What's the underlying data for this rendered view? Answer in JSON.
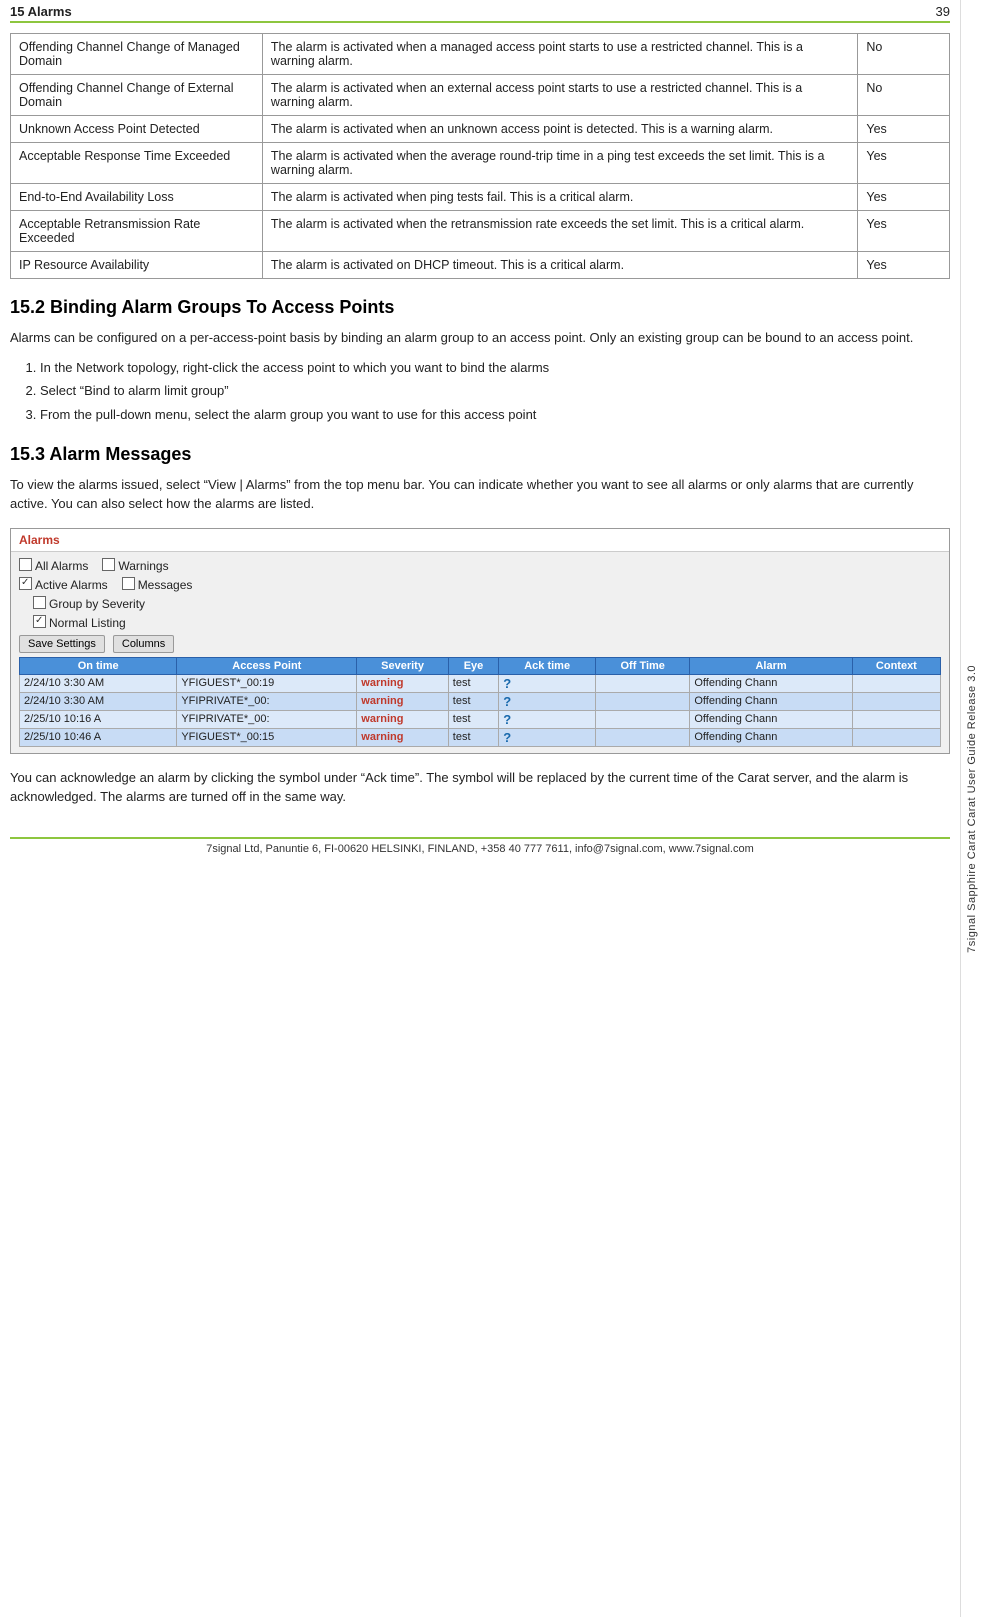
{
  "header": {
    "chapter": "15 Alarms",
    "page_number": "39"
  },
  "side_label": "7signal Sapphire Carat Carat User Guide Release 3.0",
  "table": {
    "rows": [
      {
        "name": "Offending Channel Change of Managed Domain",
        "description": "The alarm is activated when a managed access point starts to use a restricted channel. This is a warning alarm.",
        "enabled": "No"
      },
      {
        "name": "Offending Channel Change of External Domain",
        "description": "The alarm is activated when an external access point starts to use a restricted channel. This is a warning alarm.",
        "enabled": "No"
      },
      {
        "name": "Unknown Access Point Detected",
        "description": "The alarm is activated when an unknown access point is detected. This is a warning alarm.",
        "enabled": "Yes"
      },
      {
        "name": "Acceptable Response Time Exceeded",
        "description": "The alarm is activated when the average round-trip time in a ping test exceeds the set limit. This is a warning alarm.",
        "enabled": "Yes"
      },
      {
        "name": "End-to-End Availability Loss",
        "description": "The alarm is activated when ping tests fail. This is a critical alarm.",
        "enabled": "Yes"
      },
      {
        "name": "Acceptable Retransmission Rate Exceeded",
        "description": "The alarm is activated when the retransmission rate exceeds the set limit. This is a critical alarm.",
        "enabled": "Yes"
      },
      {
        "name": "IP Resource Availability",
        "description": "The alarm is activated on DHCP timeout. This is a critical alarm.",
        "enabled": "Yes"
      }
    ]
  },
  "section_15_2": {
    "heading": "15.2 Binding Alarm Groups To Access Points",
    "intro": "Alarms can be configured on a per-access-point basis by binding an alarm group to an access point. Only an existing group can be bound to an access point.",
    "steps": [
      "In the Network topology, right-click the access point to which you want to bind the alarms",
      "Select “Bind to alarm limit group”",
      "From the pull-down menu, select the alarm group you want to use for this access point"
    ]
  },
  "section_15_3": {
    "heading": "15.3 Alarm Messages",
    "intro": "To view the alarms issued, select “View | Alarms” from the top menu bar. You can indicate whether you want to see all alarms or only alarms that are currently active. You can also select how the alarms are listed.",
    "screenshot": {
      "title": "Alarms",
      "checkboxes": {
        "all_alarms": {
          "label": "All Alarms",
          "checked": false
        },
        "warnings": {
          "label": "Warnings",
          "checked": false
        },
        "active_alarms": {
          "label": "Active Alarms",
          "checked": true
        },
        "messages": {
          "label": "Messages",
          "checked": false
        },
        "group_by_severity": {
          "label": "Group by Severity",
          "checked": false
        },
        "normal_listing": {
          "label": "Normal Listing",
          "checked": true
        }
      },
      "buttons": {
        "save_settings": "Save Settings",
        "columns": "Columns"
      },
      "table_headers": [
        "On time",
        "Access Point",
        "Severity",
        "Eye",
        "Ack time",
        "Off Time",
        "Alarm",
        "Context"
      ],
      "table_rows": [
        [
          "2/24/10 3:30 AM",
          "YFIGUEST*_00:19",
          "warning",
          "test",
          "?",
          "",
          "Offending Chann",
          ""
        ],
        [
          "2/24/10 3:30 AM",
          "YFIPRIVATE*_00:",
          "warning",
          "test",
          "?",
          "",
          "Offending Chann",
          ""
        ],
        [
          "2/25/10 10:16 A",
          "YFIPRIVATE*_00:",
          "warning",
          "test",
          "?",
          "",
          "Offending Chann",
          ""
        ],
        [
          "2/25/10 10:46 A",
          "YFIGUEST*_00:15",
          "warning",
          "test",
          "?",
          "",
          "Offending Chann",
          ""
        ]
      ]
    },
    "ack_text": "You can acknowledge an alarm by clicking the symbol under “Ack time”. The symbol will be replaced by the current time of the Carat server, and the alarm is acknowledged. The alarms are turned off in the same way."
  },
  "footer": {
    "text": "7signal Ltd, Panuntie 6, FI-00620 HELSINKI, FINLAND, +358 40 777 7611, info@7signal.com, www.7signal.com"
  }
}
